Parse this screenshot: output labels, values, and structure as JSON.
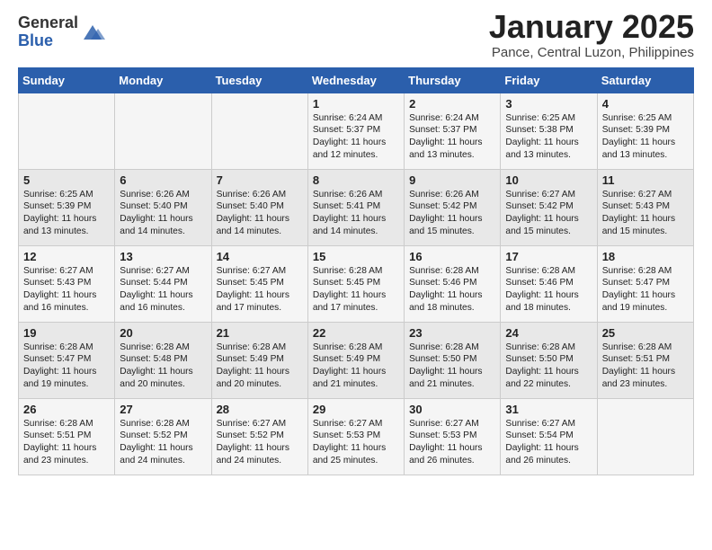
{
  "header": {
    "logo_general": "General",
    "logo_blue": "Blue",
    "main_title": "January 2025",
    "subtitle": "Pance, Central Luzon, Philippines"
  },
  "days_of_week": [
    "Sunday",
    "Monday",
    "Tuesday",
    "Wednesday",
    "Thursday",
    "Friday",
    "Saturday"
  ],
  "weeks": [
    [
      {
        "day": "",
        "content": ""
      },
      {
        "day": "",
        "content": ""
      },
      {
        "day": "",
        "content": ""
      },
      {
        "day": "1",
        "content": "Sunrise: 6:24 AM\nSunset: 5:37 PM\nDaylight: 11 hours and 12 minutes."
      },
      {
        "day": "2",
        "content": "Sunrise: 6:24 AM\nSunset: 5:37 PM\nDaylight: 11 hours and 13 minutes."
      },
      {
        "day": "3",
        "content": "Sunrise: 6:25 AM\nSunset: 5:38 PM\nDaylight: 11 hours and 13 minutes."
      },
      {
        "day": "4",
        "content": "Sunrise: 6:25 AM\nSunset: 5:39 PM\nDaylight: 11 hours and 13 minutes."
      }
    ],
    [
      {
        "day": "5",
        "content": "Sunrise: 6:25 AM\nSunset: 5:39 PM\nDaylight: 11 hours and 13 minutes."
      },
      {
        "day": "6",
        "content": "Sunrise: 6:26 AM\nSunset: 5:40 PM\nDaylight: 11 hours and 14 minutes."
      },
      {
        "day": "7",
        "content": "Sunrise: 6:26 AM\nSunset: 5:40 PM\nDaylight: 11 hours and 14 minutes."
      },
      {
        "day": "8",
        "content": "Sunrise: 6:26 AM\nSunset: 5:41 PM\nDaylight: 11 hours and 14 minutes."
      },
      {
        "day": "9",
        "content": "Sunrise: 6:26 AM\nSunset: 5:42 PM\nDaylight: 11 hours and 15 minutes."
      },
      {
        "day": "10",
        "content": "Sunrise: 6:27 AM\nSunset: 5:42 PM\nDaylight: 11 hours and 15 minutes."
      },
      {
        "day": "11",
        "content": "Sunrise: 6:27 AM\nSunset: 5:43 PM\nDaylight: 11 hours and 15 minutes."
      }
    ],
    [
      {
        "day": "12",
        "content": "Sunrise: 6:27 AM\nSunset: 5:43 PM\nDaylight: 11 hours and 16 minutes."
      },
      {
        "day": "13",
        "content": "Sunrise: 6:27 AM\nSunset: 5:44 PM\nDaylight: 11 hours and 16 minutes."
      },
      {
        "day": "14",
        "content": "Sunrise: 6:27 AM\nSunset: 5:45 PM\nDaylight: 11 hours and 17 minutes."
      },
      {
        "day": "15",
        "content": "Sunrise: 6:28 AM\nSunset: 5:45 PM\nDaylight: 11 hours and 17 minutes."
      },
      {
        "day": "16",
        "content": "Sunrise: 6:28 AM\nSunset: 5:46 PM\nDaylight: 11 hours and 18 minutes."
      },
      {
        "day": "17",
        "content": "Sunrise: 6:28 AM\nSunset: 5:46 PM\nDaylight: 11 hours and 18 minutes."
      },
      {
        "day": "18",
        "content": "Sunrise: 6:28 AM\nSunset: 5:47 PM\nDaylight: 11 hours and 19 minutes."
      }
    ],
    [
      {
        "day": "19",
        "content": "Sunrise: 6:28 AM\nSunset: 5:47 PM\nDaylight: 11 hours and 19 minutes."
      },
      {
        "day": "20",
        "content": "Sunrise: 6:28 AM\nSunset: 5:48 PM\nDaylight: 11 hours and 20 minutes."
      },
      {
        "day": "21",
        "content": "Sunrise: 6:28 AM\nSunset: 5:49 PM\nDaylight: 11 hours and 20 minutes."
      },
      {
        "day": "22",
        "content": "Sunrise: 6:28 AM\nSunset: 5:49 PM\nDaylight: 11 hours and 21 minutes."
      },
      {
        "day": "23",
        "content": "Sunrise: 6:28 AM\nSunset: 5:50 PM\nDaylight: 11 hours and 21 minutes."
      },
      {
        "day": "24",
        "content": "Sunrise: 6:28 AM\nSunset: 5:50 PM\nDaylight: 11 hours and 22 minutes."
      },
      {
        "day": "25",
        "content": "Sunrise: 6:28 AM\nSunset: 5:51 PM\nDaylight: 11 hours and 23 minutes."
      }
    ],
    [
      {
        "day": "26",
        "content": "Sunrise: 6:28 AM\nSunset: 5:51 PM\nDaylight: 11 hours and 23 minutes."
      },
      {
        "day": "27",
        "content": "Sunrise: 6:28 AM\nSunset: 5:52 PM\nDaylight: 11 hours and 24 minutes."
      },
      {
        "day": "28",
        "content": "Sunrise: 6:27 AM\nSunset: 5:52 PM\nDaylight: 11 hours and 24 minutes."
      },
      {
        "day": "29",
        "content": "Sunrise: 6:27 AM\nSunset: 5:53 PM\nDaylight: 11 hours and 25 minutes."
      },
      {
        "day": "30",
        "content": "Sunrise: 6:27 AM\nSunset: 5:53 PM\nDaylight: 11 hours and 26 minutes."
      },
      {
        "day": "31",
        "content": "Sunrise: 6:27 AM\nSunset: 5:54 PM\nDaylight: 11 hours and 26 minutes."
      },
      {
        "day": "",
        "content": ""
      }
    ]
  ]
}
